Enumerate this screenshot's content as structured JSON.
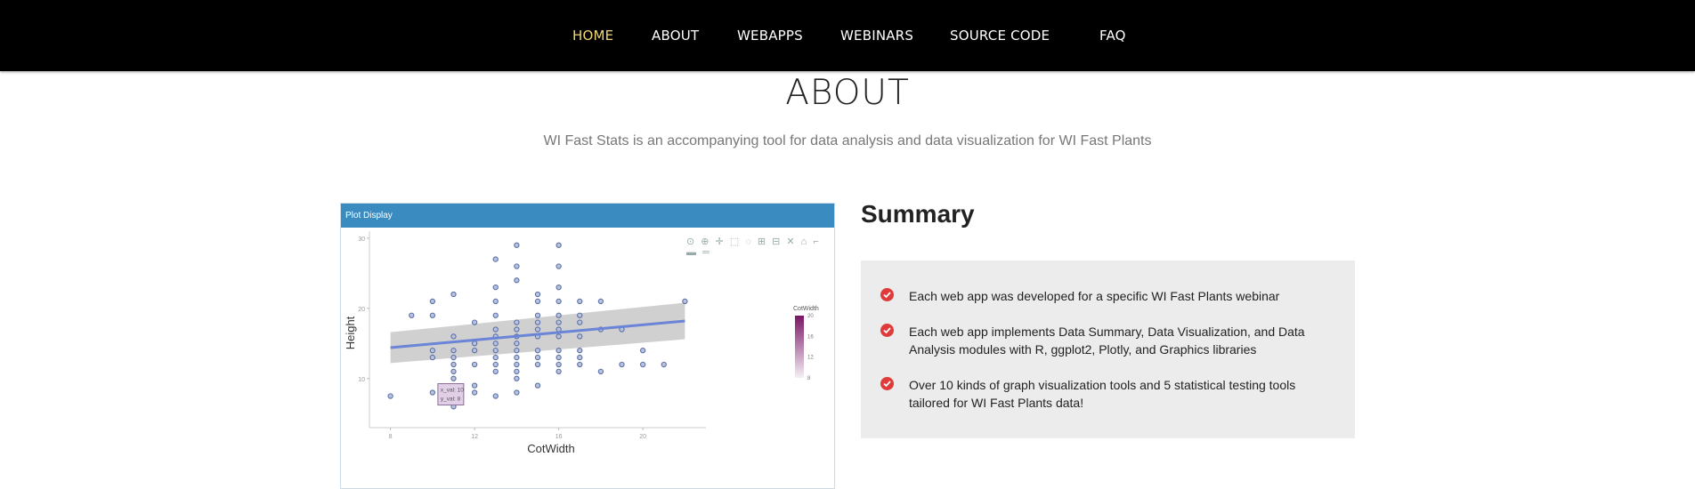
{
  "nav": {
    "items": [
      "HOME",
      "ABOUT",
      "WEBAPPS",
      "WEBINARS",
      "SOURCE CODE",
      "FAQ"
    ],
    "active": "HOME",
    "active_color": "#f0d776"
  },
  "about": {
    "title": "ABOUT",
    "subtitle": "WI Fast Stats is an accompanying tool for data analysis and data visualization for WI Fast Plants"
  },
  "plot_panel": {
    "header": "Plot Display",
    "modebar_icons": [
      "camera-icon",
      "zoom-icon",
      "pan-icon",
      "box-select-icon",
      "lasso-icon",
      "zoom-in-icon",
      "zoom-out-icon",
      "autoscale-icon",
      "reset-icon",
      "spike-icon",
      "hover-closest-icon",
      "hover-compare-icon"
    ]
  },
  "summary": {
    "title": "Summary",
    "items": [
      "Each web app was developed for a specific WI Fast Plants webinar",
      "Each web app implements Data Summary, Data Visualization, and Data Analysis modules with R, ggplot2, Plotly, and Graphics libraries",
      "Over 10 kinds of graph visualization tools and 5 statistical testing tools tailored for WI Fast Plants data!"
    ],
    "check_color": "#e03b3b"
  },
  "chart_data": {
    "type": "scatter",
    "xlabel": "CotWidth",
    "ylabel": "Height",
    "xticks": [
      8,
      12,
      16,
      20
    ],
    "yticks": [
      10,
      20,
      30
    ],
    "xlim": [
      7,
      23
    ],
    "ylim": [
      3,
      31
    ],
    "points": [
      [
        8,
        7.5
      ],
      [
        9,
        19
      ],
      [
        10,
        21
      ],
      [
        10,
        19
      ],
      [
        10,
        14
      ],
      [
        10,
        13
      ],
      [
        11,
        22
      ],
      [
        11,
        16
      ],
      [
        11,
        14
      ],
      [
        11,
        13
      ],
      [
        11,
        12
      ],
      [
        11,
        11
      ],
      [
        11,
        10
      ],
      [
        11,
        6
      ],
      [
        10,
        8
      ],
      [
        12,
        18
      ],
      [
        12,
        15
      ],
      [
        12,
        14
      ],
      [
        12,
        12
      ],
      [
        12,
        9
      ],
      [
        12,
        8
      ],
      [
        13,
        27
      ],
      [
        13,
        23
      ],
      [
        13,
        21
      ],
      [
        13,
        19
      ],
      [
        13,
        17
      ],
      [
        13,
        16
      ],
      [
        13,
        15
      ],
      [
        13,
        14
      ],
      [
        13,
        13
      ],
      [
        13,
        12
      ],
      [
        13,
        11
      ],
      [
        13,
        7.5
      ],
      [
        14,
        29
      ],
      [
        14,
        26
      ],
      [
        14,
        24
      ],
      [
        14,
        18
      ],
      [
        14,
        17
      ],
      [
        14,
        16
      ],
      [
        14,
        15
      ],
      [
        14,
        14
      ],
      [
        14,
        13
      ],
      [
        14,
        12
      ],
      [
        14,
        11
      ],
      [
        14,
        10
      ],
      [
        14,
        8
      ],
      [
        15,
        22
      ],
      [
        15,
        21
      ],
      [
        15,
        19
      ],
      [
        15,
        18
      ],
      [
        15,
        17
      ],
      [
        15,
        16
      ],
      [
        15,
        14
      ],
      [
        15,
        13
      ],
      [
        15,
        12
      ],
      [
        15,
        9
      ],
      [
        16,
        29
      ],
      [
        16,
        26
      ],
      [
        16,
        23
      ],
      [
        16,
        21
      ],
      [
        16,
        19
      ],
      [
        16,
        18
      ],
      [
        16,
        17
      ],
      [
        16,
        16
      ],
      [
        16,
        14
      ],
      [
        16,
        13
      ],
      [
        16,
        12
      ],
      [
        16,
        11
      ],
      [
        17,
        21
      ],
      [
        17,
        19
      ],
      [
        17,
        18
      ],
      [
        17,
        16
      ],
      [
        17,
        14
      ],
      [
        17,
        13
      ],
      [
        17,
        12
      ],
      [
        18,
        21
      ],
      [
        18,
        17
      ],
      [
        18,
        11
      ],
      [
        19,
        17
      ],
      [
        19,
        12
      ],
      [
        20,
        14
      ],
      [
        20,
        12
      ],
      [
        21,
        12
      ],
      [
        22,
        21
      ]
    ],
    "fit_line": {
      "x": [
        8,
        22
      ],
      "y": [
        14.4,
        18.2
      ],
      "band_lower": [
        12.2,
        15.6
      ],
      "band_upper": [
        16.6,
        20.8
      ]
    },
    "tooltip": {
      "x_val": "x_val: 10",
      "y_val": "y_val: 8"
    },
    "colorbar": {
      "title": "CotWidth",
      "ticks": [
        8,
        12,
        16,
        20
      ]
    },
    "point_color": "#5a6fa6",
    "line_color": "#6a84d8",
    "band_color": "#c8c8c8",
    "colorbar_colors": [
      "#f5f0f5",
      "#7a1566"
    ]
  }
}
